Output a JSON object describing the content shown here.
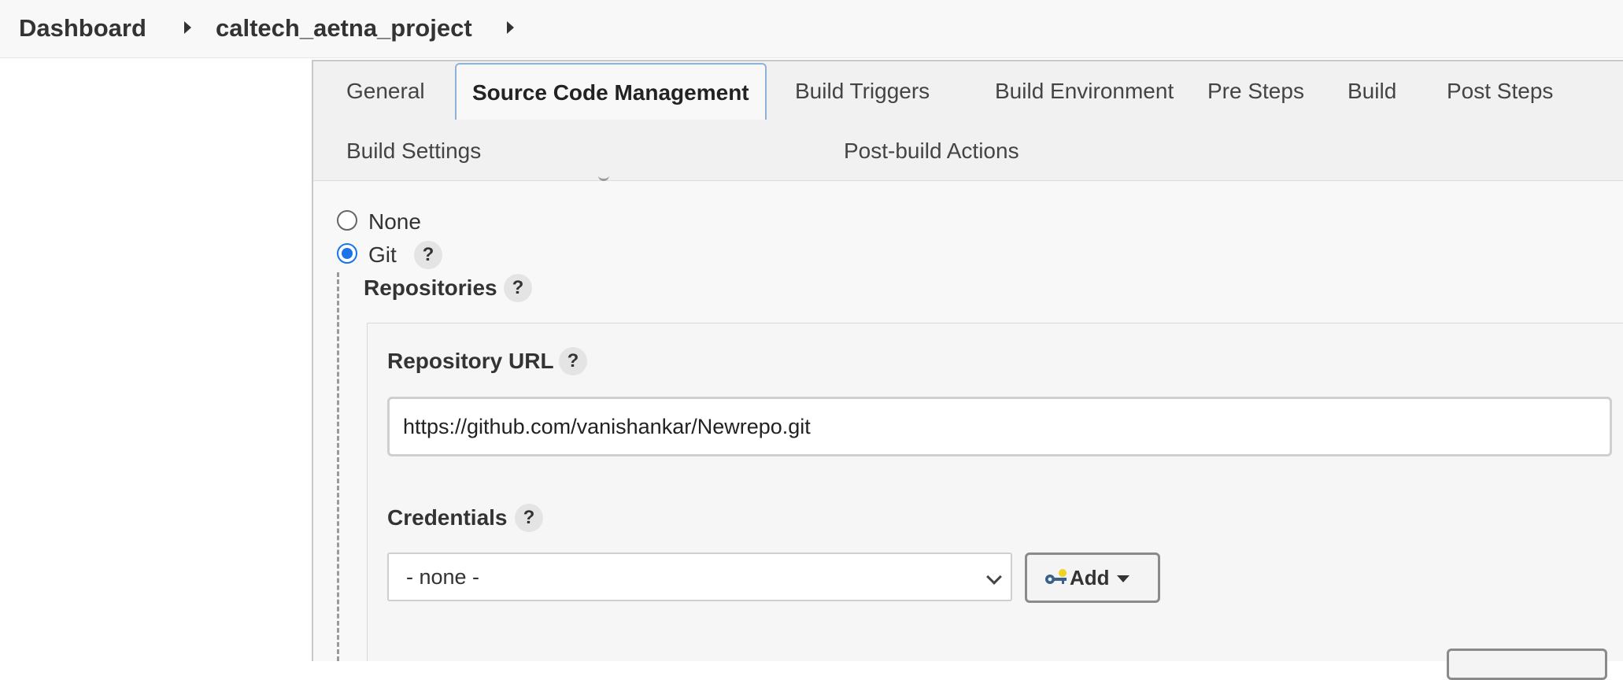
{
  "breadcrumb": {
    "items": [
      "Dashboard",
      "caltech_aetna_project"
    ]
  },
  "tabs": [
    {
      "label": "General",
      "active": false
    },
    {
      "label": "Source Code Management",
      "active": true
    },
    {
      "label": "Build Triggers",
      "active": false
    },
    {
      "label": "Build Environment",
      "active": false
    },
    {
      "label": "Pre Steps",
      "active": false
    },
    {
      "label": "Build",
      "active": false
    },
    {
      "label": "Post Steps",
      "active": false
    },
    {
      "label": "Build Settings",
      "active": false
    },
    {
      "label": "Post-build Actions",
      "active": false
    }
  ],
  "scm": {
    "options": [
      {
        "label": "None",
        "selected": false
      },
      {
        "label": "Git",
        "selected": true
      }
    ],
    "help_glyph": "?",
    "repositories_label": "Repositories",
    "repository_url_label": "Repository URL",
    "repository_url_value": "https://github.com/vanishankar/Newrepo.git",
    "credentials_label": "Credentials",
    "credentials_selected": "- none -",
    "add_button_label": "Add"
  },
  "colors": {
    "accent": "#1a73e8",
    "active_tab_border": "#8db4d8"
  },
  "icons": {
    "breadcrumb_separator": "caret-right-icon",
    "add_button_icon": "key-icon",
    "add_button_dropdown": "caret-down-icon",
    "select_dropdown": "chevron-down-icon",
    "help": "help-icon"
  }
}
